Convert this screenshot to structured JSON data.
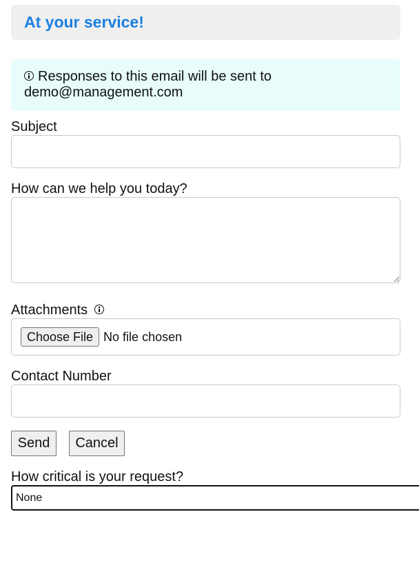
{
  "header": {
    "title": "At your service!"
  },
  "notice": {
    "text": "Responses to this email will be sent to demo@management.com"
  },
  "form": {
    "subject": {
      "label": "Subject",
      "value": ""
    },
    "message": {
      "label": "How can we help you today?",
      "value": ""
    },
    "attachments": {
      "label": "Attachments",
      "button_label": "Choose File",
      "status": "No file chosen"
    },
    "contact": {
      "label": "Contact Number",
      "value": ""
    },
    "actions": {
      "send_label": "Send",
      "cancel_label": "Cancel"
    },
    "priority": {
      "label": "How critical is your request?",
      "selected": "None"
    }
  },
  "icons": {
    "info": "info-icon"
  }
}
